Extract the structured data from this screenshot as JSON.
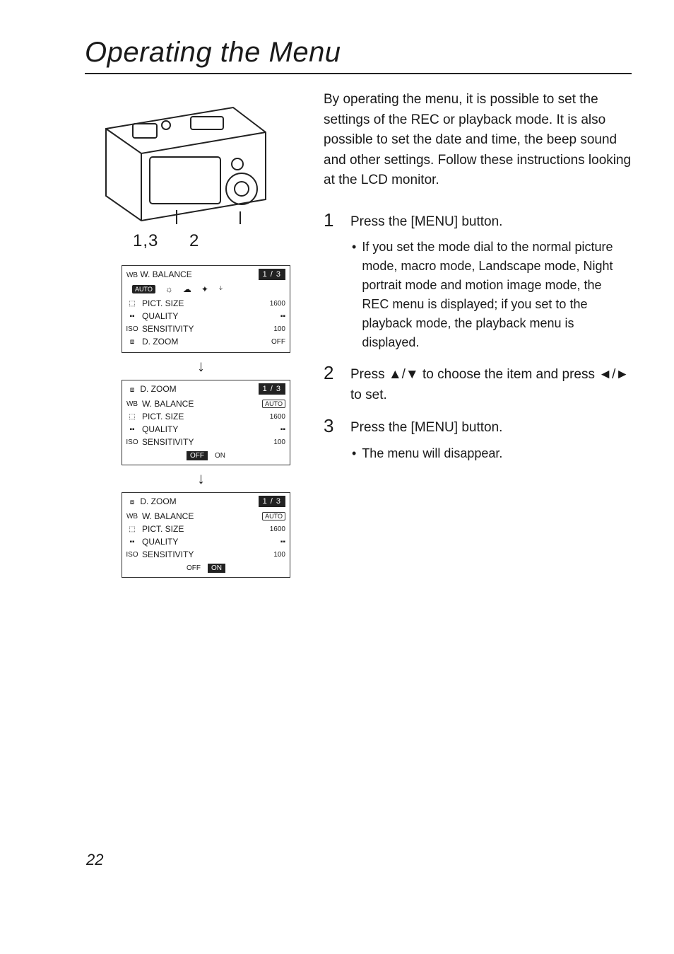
{
  "title": "Operating the Menu",
  "camera_labels": {
    "a": "1,3",
    "b": "2"
  },
  "menus": {
    "m1": {
      "head_icon": "WB",
      "head_label": "W. BALANCE",
      "page_indicator": "1 / 3",
      "wb_icons": [
        "AUTO",
        "☼",
        "☁",
        "✦",
        "ᛎ"
      ],
      "rows": [
        {
          "icon": "⬚",
          "label": "PICT. SIZE",
          "value": "1600"
        },
        {
          "icon": "▪▪",
          "label": "QUALITY",
          "value": "▪▪"
        },
        {
          "icon": "ISO",
          "label": "SENSITIVITY",
          "value": "100"
        },
        {
          "icon": "⧈",
          "label": "D. ZOOM",
          "value": "OFF"
        }
      ]
    },
    "m2": {
      "head_icon": "⧈",
      "head_label": "D. ZOOM",
      "page_indicator": "1 / 3",
      "rows": [
        {
          "icon": "WB",
          "label": "W. BALANCE",
          "value": "AUTO"
        },
        {
          "icon": "⬚",
          "label": "PICT. SIZE",
          "value": "1600"
        },
        {
          "icon": "▪▪",
          "label": "QUALITY",
          "value": "▪▪"
        },
        {
          "icon": "ISO",
          "label": "SENSITIVITY",
          "value": "100"
        }
      ],
      "toggle": {
        "off": "OFF",
        "on": "ON",
        "selected": "OFF"
      }
    },
    "m3": {
      "head_icon": "⧈",
      "head_label": "D. ZOOM",
      "page_indicator": "1 / 3",
      "rows": [
        {
          "icon": "WB",
          "label": "W. BALANCE",
          "value": "AUTO"
        },
        {
          "icon": "⬚",
          "label": "PICT. SIZE",
          "value": "1600"
        },
        {
          "icon": "▪▪",
          "label": "QUALITY",
          "value": "▪▪"
        },
        {
          "icon": "ISO",
          "label": "SENSITIVITY",
          "value": "100"
        }
      ],
      "toggle": {
        "off": "OFF",
        "on": "ON",
        "selected": "ON"
      }
    }
  },
  "right": {
    "intro": "By operating the menu, it is possible to set the settings of the REC or playback mode. It is also possible to set the date and time, the beep sound and other settings. Follow these instructions looking at the LCD monitor.",
    "steps": [
      {
        "num": "1",
        "text": "Press the [MENU] button.",
        "bullet": "If you set the mode dial to the normal picture mode, macro mode, Landscape mode, Night portrait mode and motion image mode, the REC menu is displayed; if you set to the playback mode, the playback menu is displayed."
      },
      {
        "num": "2",
        "text": "Press ▲/▼ to choose the item and press ◄/► to set."
      },
      {
        "num": "3",
        "text": "Press the [MENU] button.",
        "bullet": "The menu will disappear."
      }
    ]
  },
  "arrow": "↓",
  "page_number": "22"
}
